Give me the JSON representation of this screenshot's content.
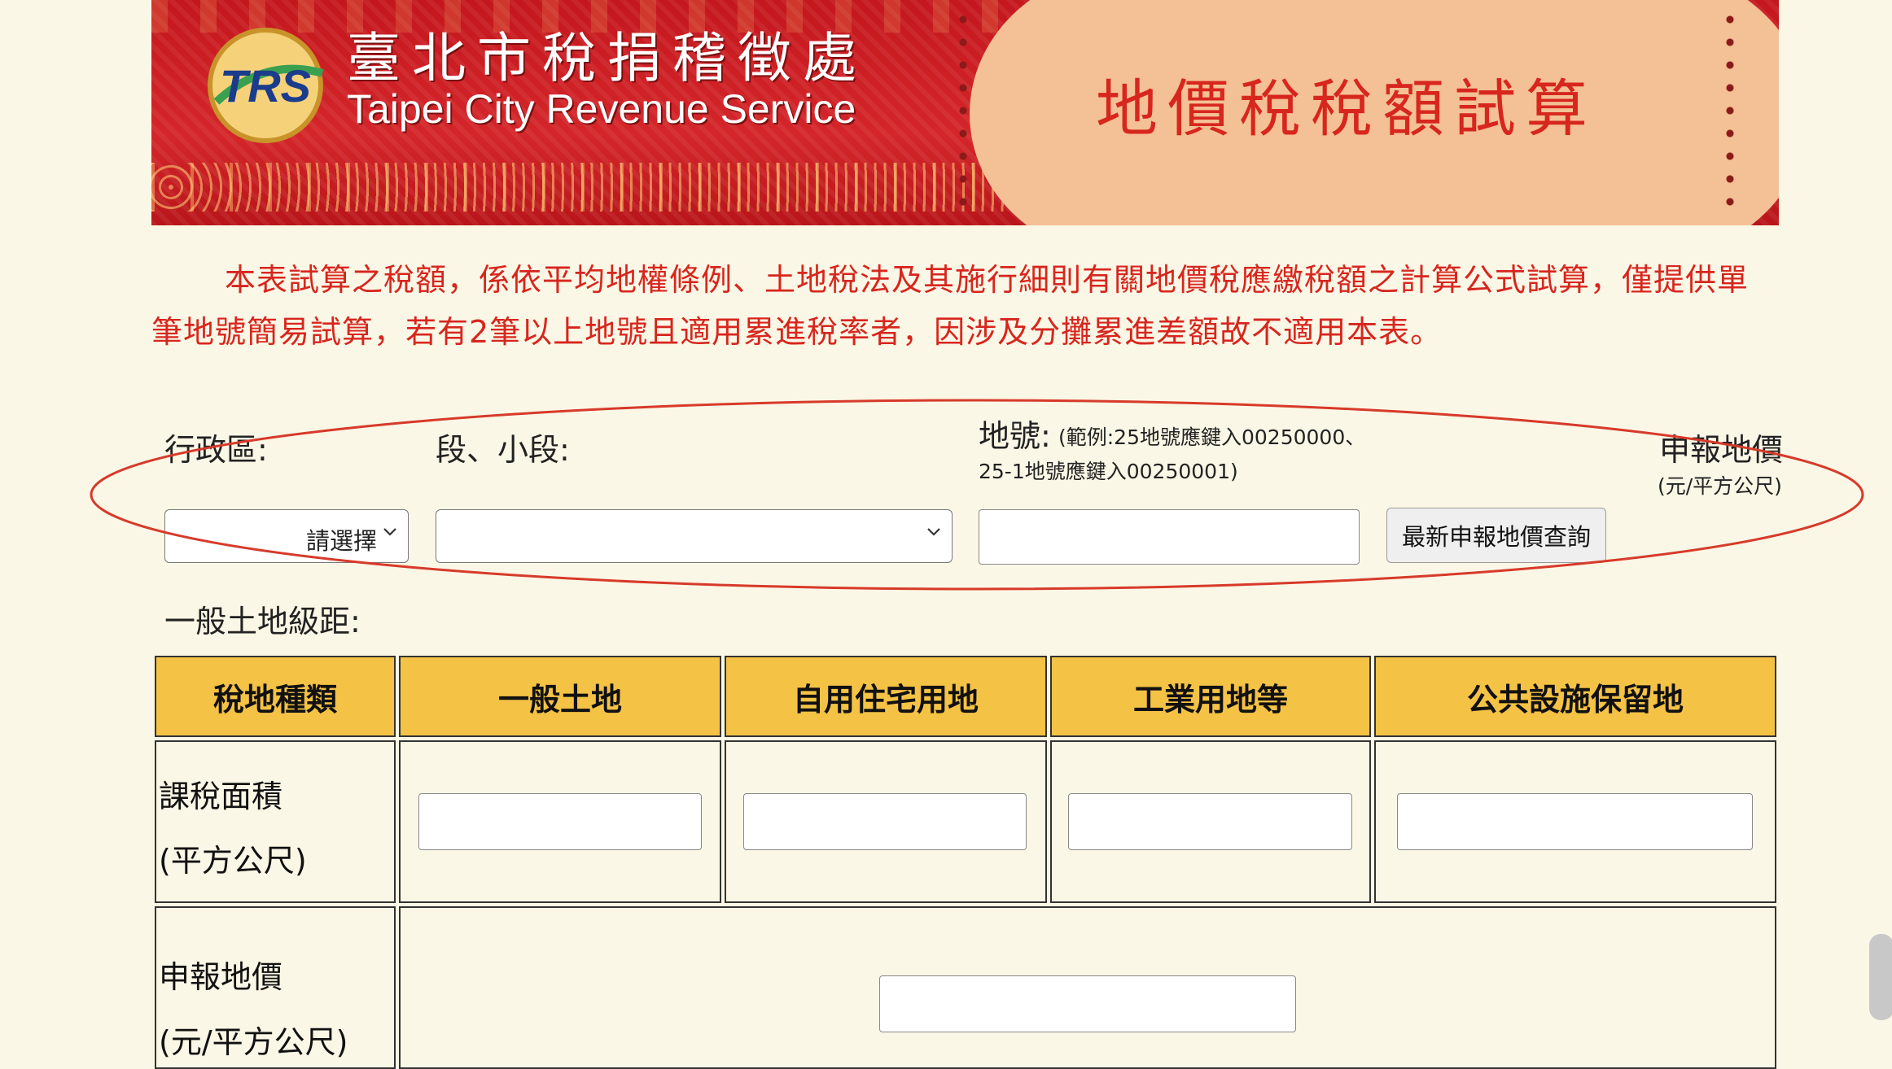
{
  "banner": {
    "logo_text": "TRS",
    "agency_name_zh": "臺北市稅捐稽徵處",
    "agency_name_en": "Taipei City Revenue Service",
    "page_title": "地價稅稅額試算"
  },
  "notice": "本表試算之稅額，係依平均地權條例、土地稅法及其施行細則有關地價稅應繳稅額之計算公式試算，僅提供單筆地號簡易試算，若有2筆以上地號且適用累進稅率者，因涉及分攤累進差額故不適用本表。",
  "form": {
    "district_label": "行政區:",
    "district_value": "請選擇",
    "section_label": "段、小段:",
    "section_value": "",
    "land_no_label": "地號:",
    "land_no_hint_line1": "(範例:25地號應鍵入00250000、",
    "land_no_hint_line2": "25-1地號應鍵入00250001)",
    "land_no_value": "",
    "declared_value_label": "申報地價",
    "declared_value_unit": "(元/平方公尺)",
    "query_button": "最新申報地價查詢"
  },
  "table": {
    "section_label": "一般土地級距:",
    "headers": [
      "稅地種類",
      "一般土地",
      "自用住宅用地",
      "工業用地等",
      "公共設施保留地"
    ],
    "rows": [
      {
        "label_line1": "課稅面積",
        "label_line2": "(平方公尺)",
        "values": [
          "",
          "",
          "",
          ""
        ]
      },
      {
        "label_line1": "申報地價",
        "label_line2": "(元/平方公尺)",
        "value": ""
      }
    ]
  },
  "colors": {
    "banner_red": "#d4262a",
    "notice_red": "#d7261e",
    "header_yellow": "#f4c245",
    "page_bg": "#fbf7e6",
    "annotation": "#d73a2a"
  }
}
